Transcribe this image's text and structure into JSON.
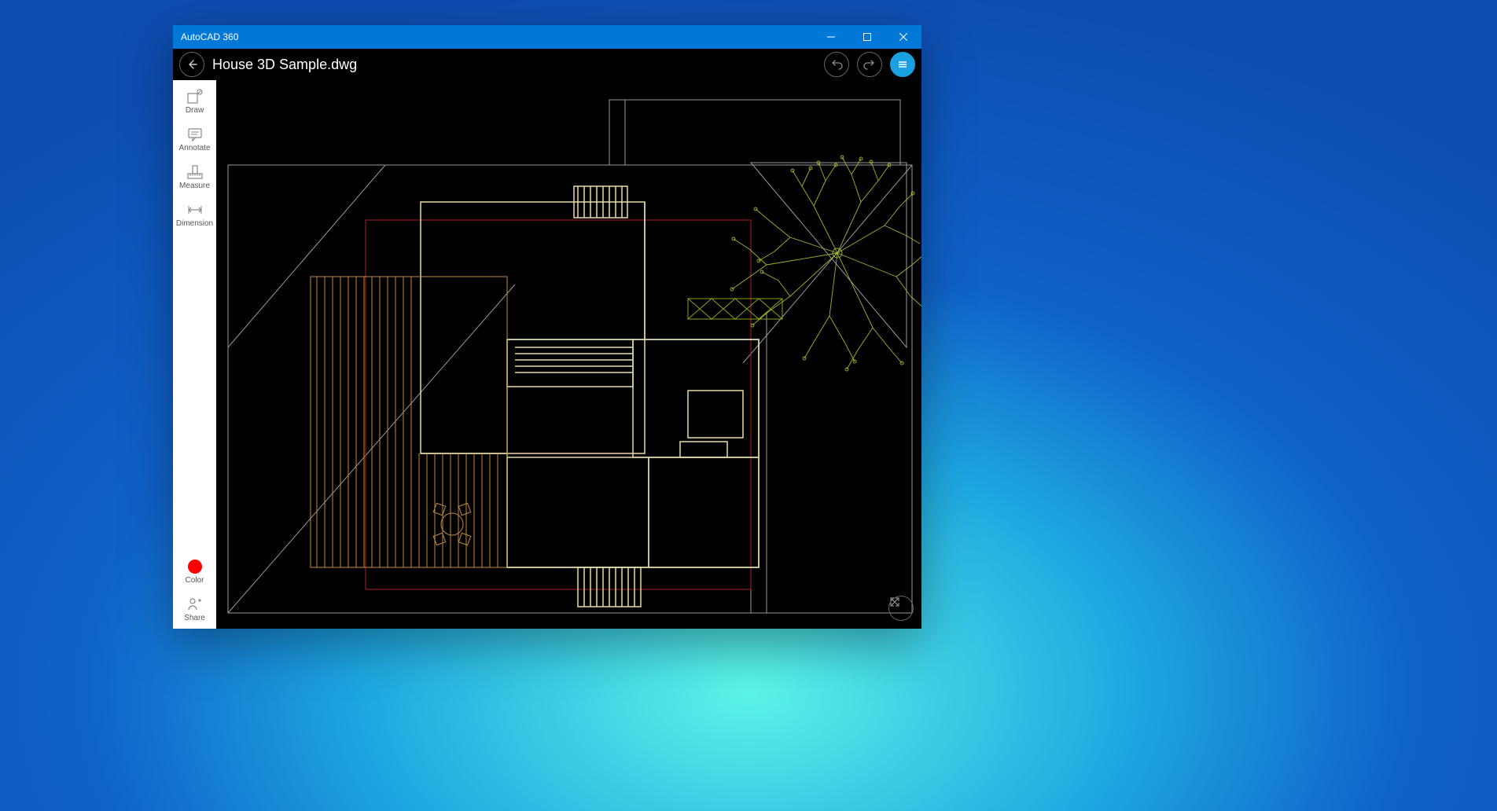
{
  "window": {
    "title": "AutoCAD 360"
  },
  "header": {
    "filename": "House 3D Sample.dwg"
  },
  "sidebar": {
    "tools": [
      {
        "id": "draw",
        "label": "Draw"
      },
      {
        "id": "annotate",
        "label": "Annotate"
      },
      {
        "id": "measure",
        "label": "Measure"
      },
      {
        "id": "dimension",
        "label": "Dimension"
      }
    ],
    "bottom": [
      {
        "id": "color",
        "label": "Color",
        "color": "#ff0000"
      },
      {
        "id": "share",
        "label": "Share"
      }
    ]
  }
}
